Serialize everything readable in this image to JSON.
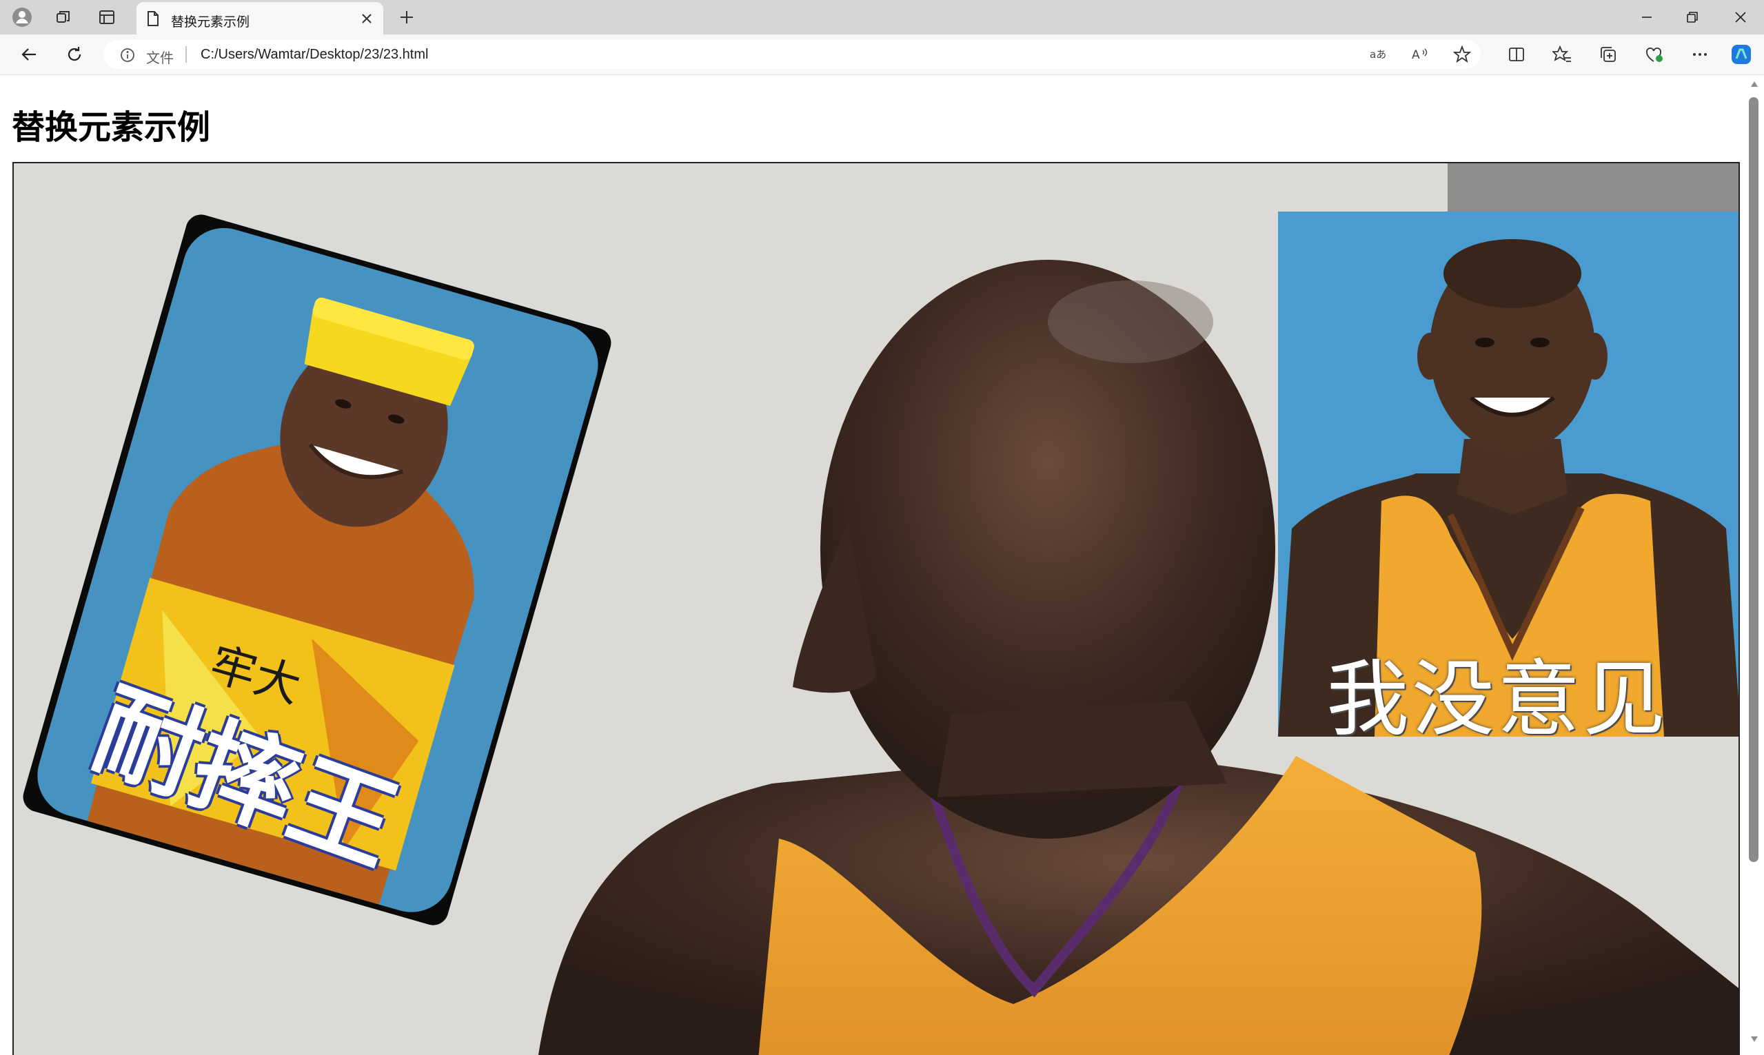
{
  "browser": {
    "tab": {
      "title": "替换元素示例"
    },
    "address": {
      "label": "文件",
      "url": "C:/Users/Wamtar/Desktop/23/23.html"
    }
  },
  "page": {
    "heading": "替换元素示例",
    "bottle_card": {
      "brand_text": "牢大",
      "name_text": "耐摔王"
    },
    "right_card": {
      "caption": "我没意见"
    }
  },
  "colors": {
    "titlebar_bg": "#d6d6d6",
    "toolbar_bg": "#f7f7f7",
    "card_blue": "#4a9bd0",
    "jersey_gold": "#f2a826",
    "accent_copilot": "#1f7ae0"
  }
}
